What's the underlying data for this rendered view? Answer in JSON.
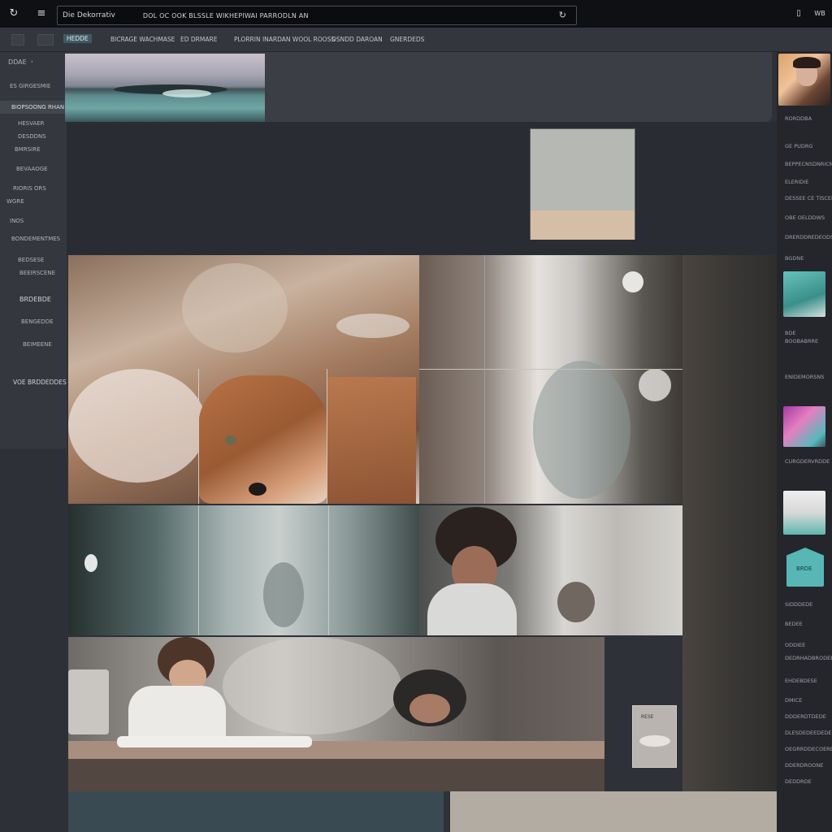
{
  "topbar": {
    "back_icon": "refresh-icon",
    "menu_icon": "z-icon",
    "site": "Die Dekorrativ",
    "path": "DOL OC OOK BLSSLE WIKHEPIWAI PARRODLN AN",
    "arrow": "↻",
    "right_a": "▯",
    "right_b": "WB"
  },
  "subnav": {
    "tabs": [
      {
        "label": "HEDDE",
        "active": true
      },
      {
        "label": "BICRAGE WACHMASE",
        "active": false
      },
      {
        "label": "ED DRMARE",
        "active": false
      },
      {
        "label": "PLORRIN INARDAN WOOL ROOSS",
        "active": false
      },
      {
        "label": "OSNDD DAROAN",
        "active": false
      },
      {
        "label": "GNERDEDS",
        "active": false
      }
    ]
  },
  "sidebar": {
    "top_label": "DDAE",
    "top_icon": "chevron-icon",
    "items": [
      "ES GIRGESMIE",
      "BIOPSOONG RHAN",
      "HESVAER",
      "DESDDNS",
      "BMRSIRE",
      "BEVAAOGE",
      "RIORIS ORS",
      "WGRE",
      "INOS",
      "BONDEMENTMES",
      "BEDSESE",
      "BEEIRSCENE",
      "BRDEBDE",
      "BENGEDDE",
      "BEIMEENE",
      "VOE BRDDEDDES"
    ]
  },
  "rightbar": {
    "items": [
      "RORDDBA",
      "GE PUDRG",
      "BEPPECNSDNRICMES",
      "ELERIDIE",
      "DESSEE CE TISCEBE",
      "OBE OELDDWS",
      "DRERDDREDEODSREN",
      "BGDNE",
      "BDE",
      "BOOBABRRE",
      "ENIDEMORSNS",
      "CURGDERVRDDE",
      "SIDDDEDE",
      "BEDEE",
      "ODDIEE",
      "DEDRHADBRODEE",
      "EHDEBDESE",
      "DMICE",
      "DDDERDTDEDE",
      "DLESDEDEEDEDE",
      "OEGRRDDECOERE",
      "DDERDROONE",
      "DEDDRDE"
    ],
    "badge": "BRDE"
  },
  "card": {
    "label": "RESE"
  },
  "colors": {
    "accent": "#3f5a66",
    "teal": "#4aa3a0",
    "topbar": "#0f1014"
  }
}
